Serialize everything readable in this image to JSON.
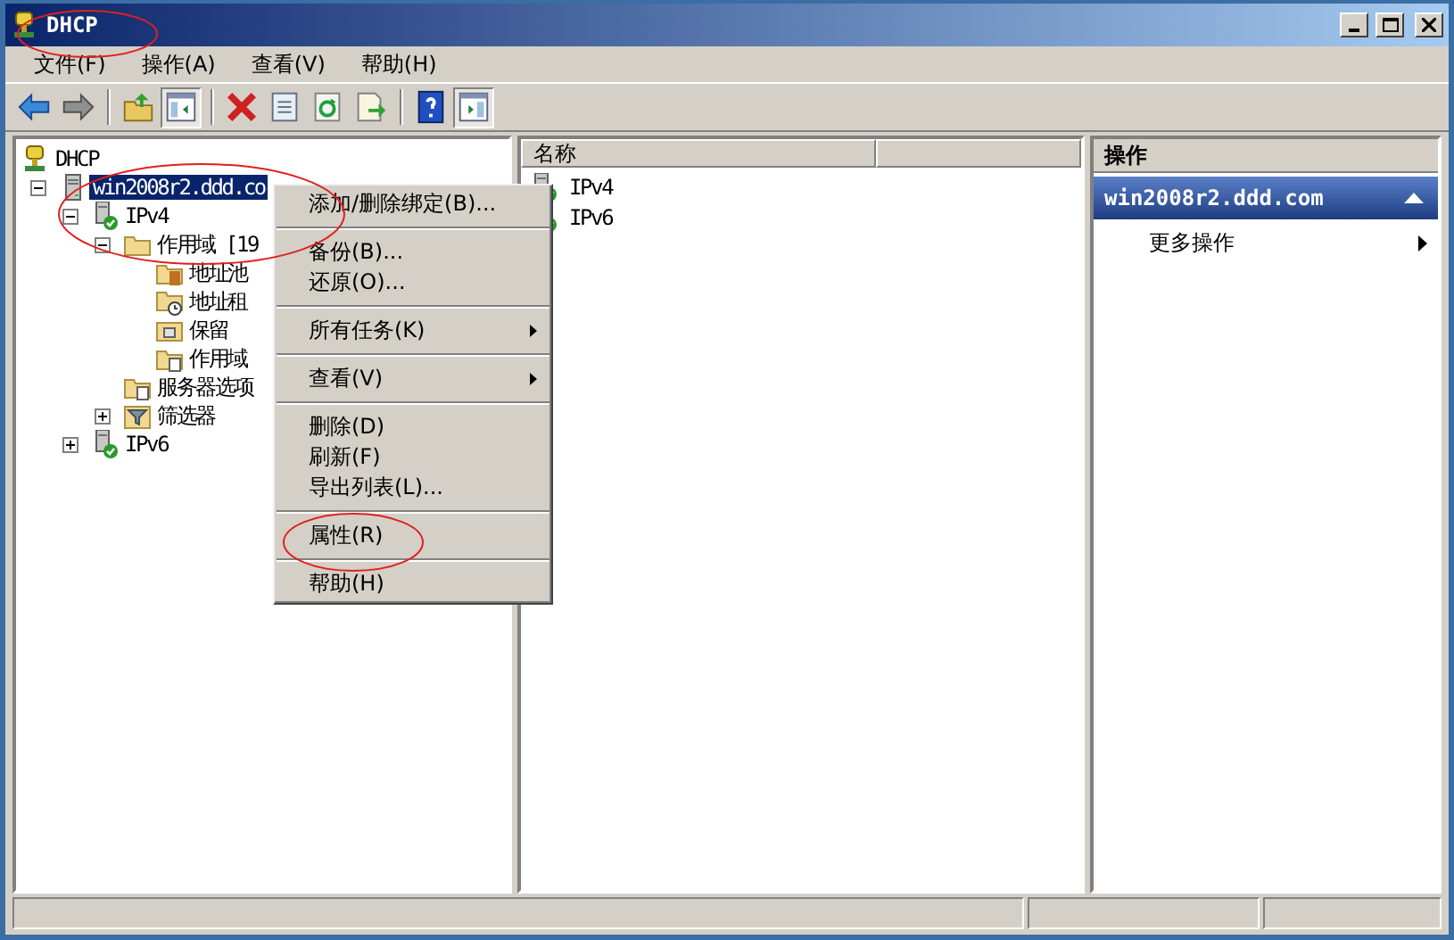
{
  "window": {
    "title": "DHCP"
  },
  "menu_bar": [
    "文件(F)",
    "操作(A)",
    "查看(V)",
    "帮助(H)"
  ],
  "toolbar": [
    {
      "kind": "back",
      "pressed": false
    },
    {
      "kind": "forward",
      "pressed": false
    },
    {
      "kind": "separator"
    },
    {
      "kind": "up",
      "pressed": false
    },
    {
      "kind": "tree-pane",
      "pressed": true
    },
    {
      "kind": "separator"
    },
    {
      "kind": "delete",
      "pressed": false
    },
    {
      "kind": "properties",
      "pressed": false
    },
    {
      "kind": "refresh",
      "pressed": false
    },
    {
      "kind": "export",
      "pressed": false
    },
    {
      "kind": "separator"
    },
    {
      "kind": "help",
      "pressed": false
    },
    {
      "kind": "action-pane",
      "pressed": true
    }
  ],
  "tree": [
    {
      "label": "DHCP",
      "kind": "dhcp",
      "selected": false,
      "children": [
        {
          "label": "win2008r2.ddd.co",
          "kind": "server",
          "selected": true,
          "expanded": true,
          "children": [
            {
              "label": "IPv4",
              "kind": "server-ok",
              "selected": false,
              "expanded": true,
              "children": [
                {
                  "label": "作用域 [19",
                  "kind": "folder",
                  "selected": false,
                  "expanded": true,
                  "children": [
                    {
                      "label": "地址池",
                      "kind": "pool",
                      "selected": false
                    },
                    {
                      "label": "地址租",
                      "kind": "leases",
                      "selected": false
                    },
                    {
                      "label": "保留",
                      "kind": "reservations",
                      "selected": false
                    },
                    {
                      "label": "作用域",
                      "kind": "options",
                      "selected": false
                    }
                  ]
                },
                {
                  "label": "服务器选项",
                  "kind": "options",
                  "selected": false
                },
                {
                  "label": "筛选器",
                  "kind": "filter",
                  "selected": false,
                  "expanded": false
                }
              ]
            },
            {
              "label": "IPv6",
              "kind": "server-ok",
              "selected": false,
              "expanded": false
            }
          ]
        }
      ]
    }
  ],
  "list": {
    "columns": [
      "名称"
    ],
    "rows": [
      {
        "label": "IPv4"
      },
      {
        "label": "IPv6"
      }
    ]
  },
  "actions": {
    "header": "操作",
    "section": {
      "title": "win2008r2.ddd.com",
      "expanded": true
    },
    "items": [
      {
        "label": "更多操作"
      }
    ]
  },
  "context_menu": [
    {
      "kind": "item",
      "label": "添加/删除绑定(B)..."
    },
    {
      "kind": "separator"
    },
    {
      "kind": "item",
      "label": "备份(B)..."
    },
    {
      "kind": "item",
      "label": "还原(O)..."
    },
    {
      "kind": "separator"
    },
    {
      "kind": "submenu",
      "label": "所有任务(K)"
    },
    {
      "kind": "separator"
    },
    {
      "kind": "submenu",
      "label": "查看(V)"
    },
    {
      "kind": "separator"
    },
    {
      "kind": "item",
      "label": "删除(D)"
    },
    {
      "kind": "item",
      "label": "刷新(F)"
    },
    {
      "kind": "item",
      "label": "导出列表(L)..."
    },
    {
      "kind": "separator"
    },
    {
      "kind": "item",
      "label": "属性(R)"
    },
    {
      "kind": "separator"
    },
    {
      "kind": "item",
      "label": "帮助(H)"
    }
  ]
}
